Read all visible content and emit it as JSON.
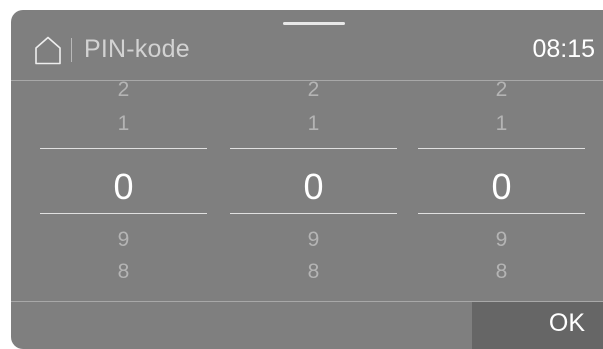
{
  "header": {
    "home_icon": "home-icon",
    "title": "PIN-kode",
    "time": "08:15"
  },
  "pin": {
    "wheels": [
      {
        "above2": "2",
        "above1": "1",
        "selected": "0",
        "below1": "9",
        "below2": "8"
      },
      {
        "above2": "2",
        "above1": "1",
        "selected": "0",
        "below1": "9",
        "below2": "8"
      },
      {
        "above2": "2",
        "above1": "1",
        "selected": "0",
        "below1": "9",
        "below2": "8"
      }
    ]
  },
  "footer": {
    "ok_label": "OK"
  },
  "colors": {
    "background": "#7f7f7f",
    "ok_button": "#666666",
    "selected_text": "#ffffff",
    "dim_text": "#b4b4b4"
  }
}
